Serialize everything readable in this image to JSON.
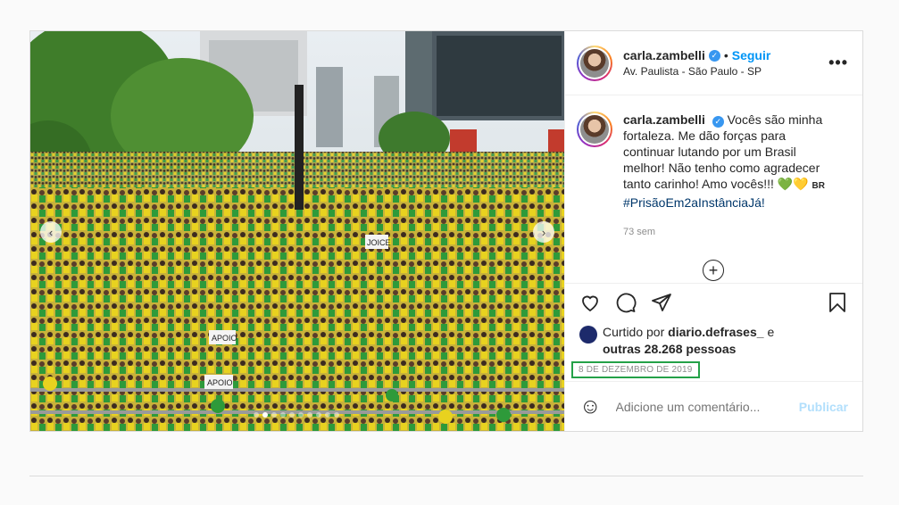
{
  "header": {
    "username": "carla.zambelli",
    "separator": "•",
    "follow_label": "Seguir",
    "location": "Av. Paulista - São Paulo - SP",
    "more_label": "•••"
  },
  "media": {
    "prev_label": "‹",
    "next_label": "›",
    "slides_total": 10,
    "active_slide": 2,
    "sign_1": "APOIO",
    "sign_2": "JOICE",
    "sign_3": "APOIO"
  },
  "caption": {
    "username": "carla.zambelli",
    "text": "Vocês são minha fortaleza. Me dão forças para continuar lutando por um Brasil melhor! Não tenho como agradecer tanto carinho! Amo vocês!!!",
    "heart_green": "💚",
    "heart_yellow": "💛",
    "flag_text": "BR",
    "hashtag": "#PrisãoEm2aInstânciaJá!",
    "time_ago": "73 sem",
    "load_more": "+"
  },
  "actions": {
    "like_icon": "heart-icon",
    "comment_icon": "comment-icon",
    "share_icon": "share-icon",
    "save_icon": "bookmark-icon"
  },
  "likes": {
    "prefix": "Curtido por",
    "liker": "diario.defrases_",
    "conj": "e",
    "others": "outras 28.268 pessoas"
  },
  "date": "8 DE DEZEMBRO DE 2019",
  "comment_box": {
    "emoji_icon": "☺",
    "placeholder": "Adicione um comentário...",
    "publish_label": "Publicar"
  },
  "colors": {
    "accent": "#0095f6",
    "highlight_box": "#24a148",
    "publish_disabled": "#b2dffc"
  }
}
